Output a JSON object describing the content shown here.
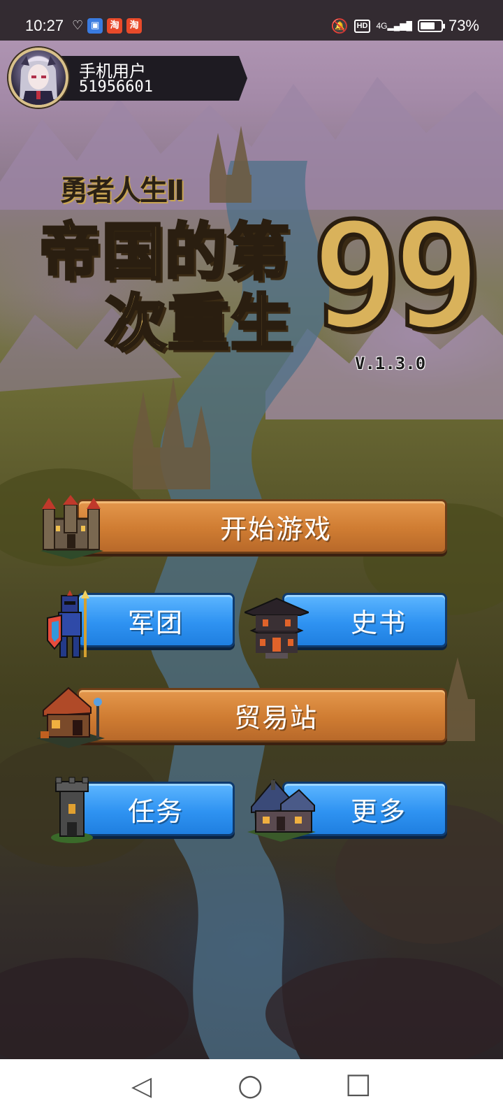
{
  "status_bar": {
    "time": "10:27",
    "badges": [
      {
        "name": "app-badge-1",
        "glyph": "▣",
        "color": "#3a7be0"
      },
      {
        "name": "taobao-badge-1",
        "glyph": "淘",
        "color": "#e84a2a"
      },
      {
        "name": "taobao-badge-2",
        "glyph": "淘",
        "color": "#e84a2a"
      }
    ],
    "hd": "HD",
    "network": "4G",
    "battery_percent": "73%",
    "battery_level": 0.73
  },
  "profile": {
    "name": "手机用户",
    "id": "51956601"
  },
  "title": {
    "subtitle": "勇者人生Ⅱ",
    "line1": "帝国的第",
    "line2": "次重生",
    "number": "99",
    "version": "V.1.3.0"
  },
  "menu": {
    "start": "开始游戏",
    "legion": "军团",
    "history": "史书",
    "trade": "贸易站",
    "quests": "任务",
    "more": "更多"
  },
  "colors": {
    "orange_button": "#cf7c32",
    "blue_button": "#2f93f2",
    "title_gold": "#d9b25b"
  },
  "nav_bar": {
    "back": "◁",
    "home": "○",
    "recents": "□"
  }
}
